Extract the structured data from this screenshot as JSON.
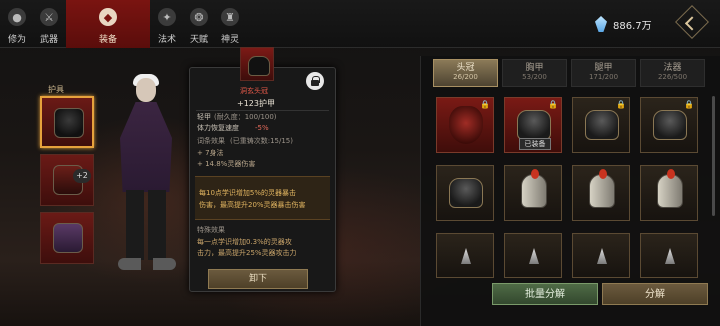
{
  "tabs": [
    {
      "label": "修为",
      "icon": "person-icon"
    },
    {
      "label": "武器",
      "icon": "sword-icon"
    },
    {
      "label": "装备",
      "icon": "armor-icon",
      "active": true
    },
    {
      "label": "法术",
      "icon": "spell-icon"
    },
    {
      "label": "天赋",
      "icon": "talent-icon"
    },
    {
      "label": "神灵",
      "icon": "deity-icon"
    }
  ],
  "currency": {
    "value": "886.7万",
    "icon": "crystal-icon"
  },
  "equipment": {
    "section_label": "护具",
    "slot2_badge": "+2"
  },
  "tooltip": {
    "name": "洞玄头冠",
    "main_stat": "+123护甲",
    "type": "轻甲",
    "durability": "(耐久度：100/100)",
    "stat_line1_label": "体力恢复速度",
    "stat_line1_value": "-5%",
    "bonus_label": "词条效果",
    "bonus_detail": "(已重铸次数:15/15)",
    "bonus1": "+ 7身法",
    "bonus2": "+ 14.8%灵器伤害",
    "highlight_text1": "每10点学识增加5%的灵器暴击",
    "highlight_text2": "伤害，最高提升20%灵器暴击伤害",
    "special_label": "特殊效果",
    "special_text1": "每一点学识增加0.3%的灵器攻",
    "special_text2": "击力，最高提升25%灵器攻击力",
    "unequip_label": "卸下"
  },
  "inventory": {
    "tabs": [
      {
        "label": "头冠",
        "count": "26/200",
        "active": true
      },
      {
        "label": "胸甲",
        "count": "53/200"
      },
      {
        "label": "腿甲",
        "count": "171/200"
      },
      {
        "label": "法器",
        "count": "226/500"
      }
    ],
    "equipped_label": "已装备",
    "bulk_disassemble_label": "批量分解",
    "disassemble_label": "分解"
  }
}
